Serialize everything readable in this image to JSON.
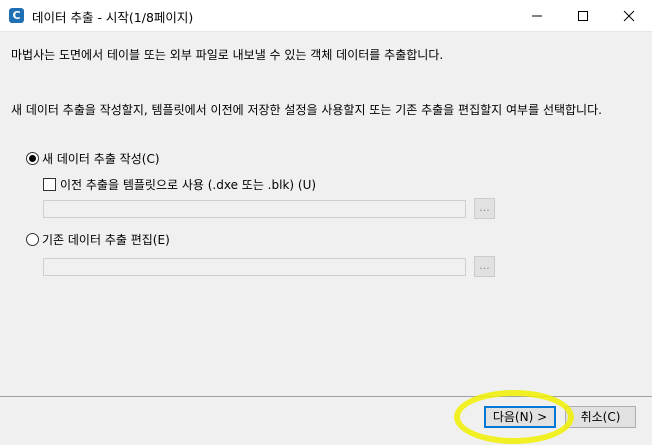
{
  "window": {
    "title": "데이터 추출 - 시작(1/8페이지)",
    "app_icon_letter": "C"
  },
  "content": {
    "intro": "마법사는 도면에서 테이블 또는 외부 파일로 내보낼 수 있는 객체 데이터를 추출합니다.",
    "question": "새 데이터 추출을 작성할지, 템플릿에서 이전에 저장한 설정을 사용할지 또는 기존 추출을 편집할지 여부를 선택합니다.",
    "option_new": {
      "label": "새 데이터 추출 작성(C)",
      "selected": true
    },
    "template_checkbox": {
      "label": "이전 추출을 템플릿으로 사용 (.dxe 또는 .blk) (U)",
      "checked": false
    },
    "option_edit": {
      "label": "기존 데이터 추출 편집(E)",
      "selected": false
    },
    "browse_label": "..."
  },
  "footer": {
    "next_label": "다음(N) >",
    "cancel_label": "취소(C)"
  },
  "colors": {
    "annotation_highlight": "#f0f000",
    "focus_border": "#0078d7"
  }
}
